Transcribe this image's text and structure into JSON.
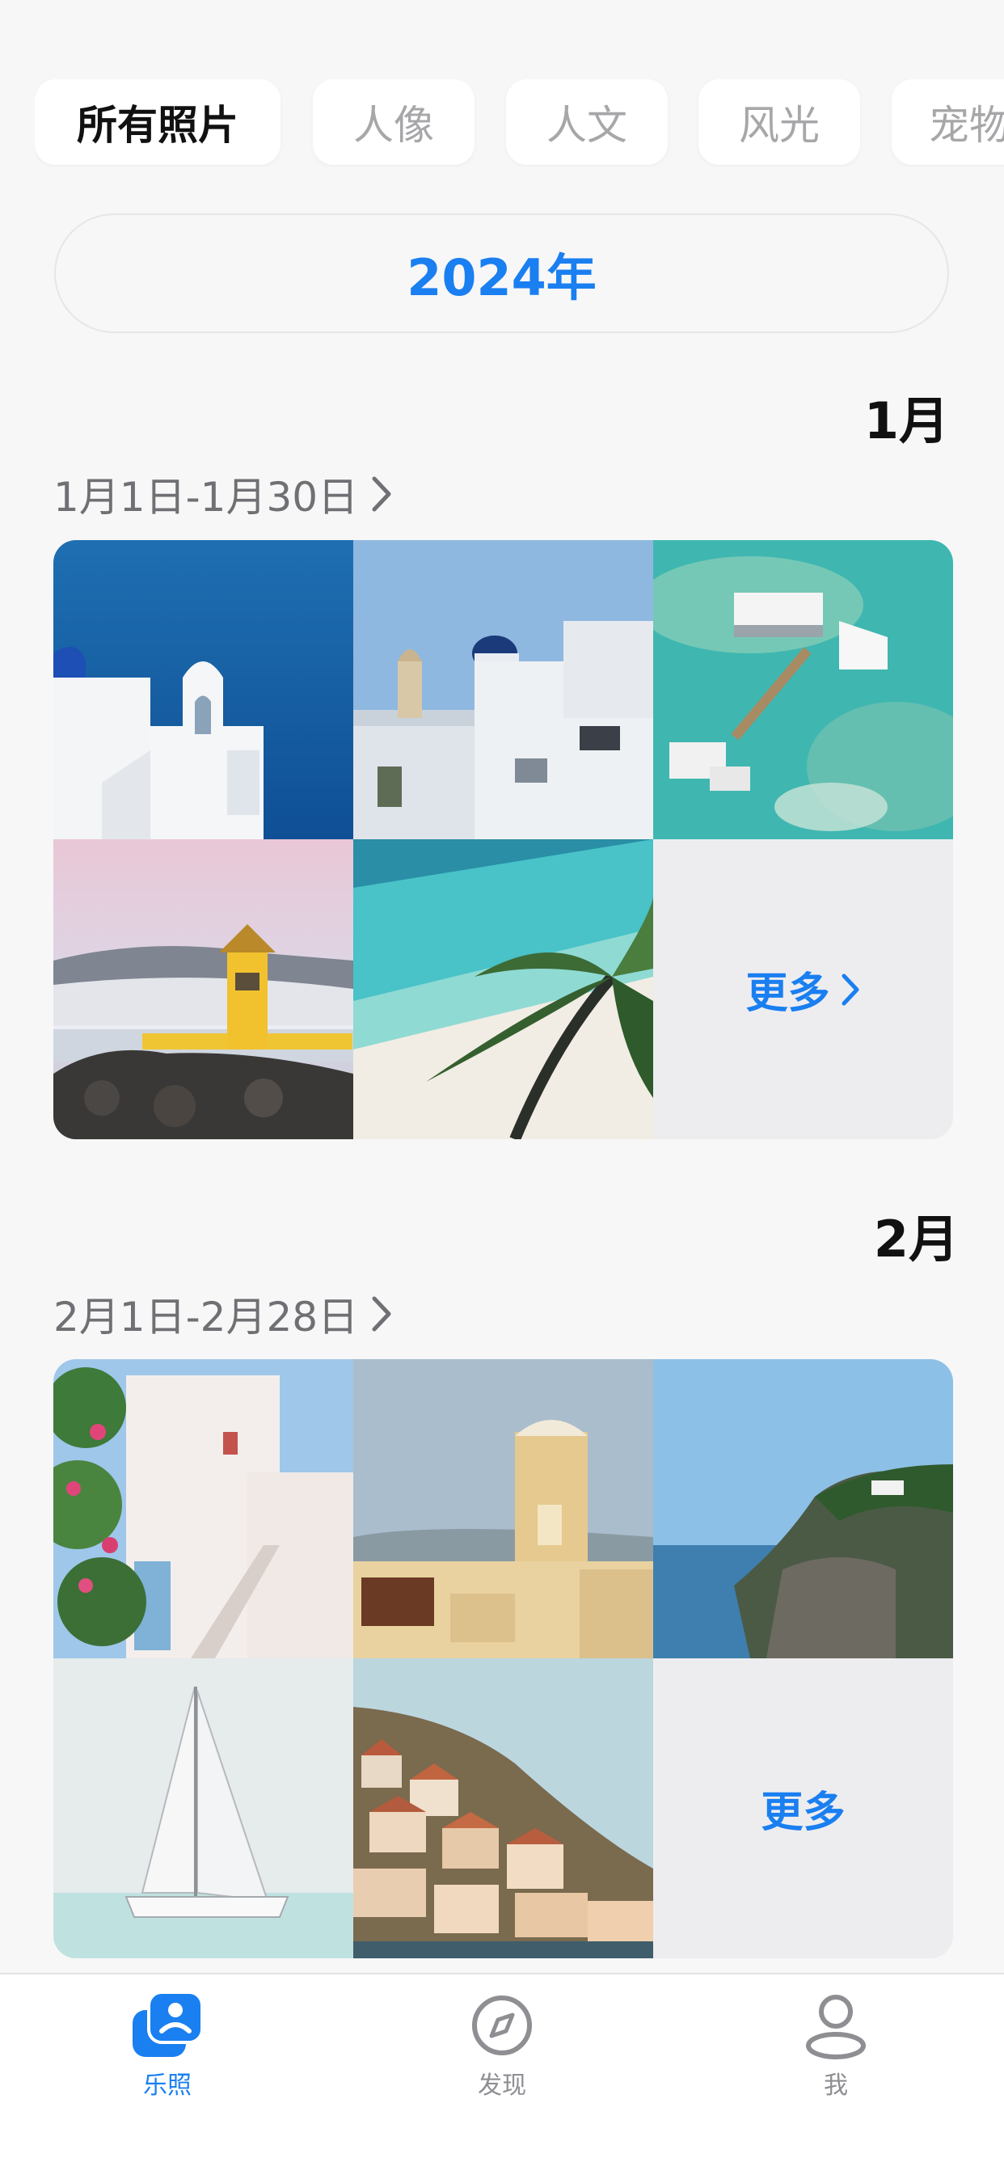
{
  "categories": [
    {
      "label": "所有照片",
      "active": true
    },
    {
      "label": "人像",
      "active": false
    },
    {
      "label": "人文",
      "active": false
    },
    {
      "label": "风光",
      "active": false
    },
    {
      "label": "宠物",
      "active": false
    }
  ],
  "year": "2024年",
  "months": [
    {
      "title": "1月",
      "range": "1月1日-1月30日",
      "more_label": "更多",
      "photos": [
        "santorini-bell-tower",
        "white-village-church",
        "overwater-villa-reef",
        "yellow-lighthouse",
        "beach-palm"
      ]
    },
    {
      "title": "2月",
      "range": "2月1日-2月28日",
      "more_label": "更多",
      "photos": [
        "white-house-bougainvillea",
        "yellow-windmill-terrace",
        "coastal-cliff",
        "white-catamaran",
        "hillside-town"
      ]
    }
  ],
  "tabs": [
    {
      "label": "乐照",
      "icon": "photos-icon",
      "active": true
    },
    {
      "label": "发现",
      "icon": "compass-icon",
      "active": false
    },
    {
      "label": "我",
      "icon": "profile-icon",
      "active": false
    }
  ],
  "colors": {
    "accent": "#1a7ff0",
    "background": "#f7f7f8",
    "inactive": "#a7a7aa"
  }
}
